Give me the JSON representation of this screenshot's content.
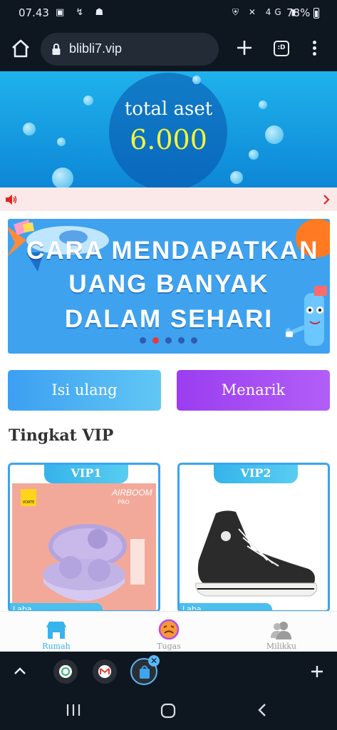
{
  "status_bar": {
    "time": "07.43",
    "battery": "78%",
    "network": "4G"
  },
  "browser": {
    "url": "blibli7.vip",
    "tabs_label": ":D"
  },
  "hero": {
    "title": "total aset",
    "value": "6.000"
  },
  "banner": {
    "line1": "CARA MENDAPATKAN",
    "line2": "UANG BANYAK",
    "line3": "DALAM SEHARI",
    "slide_count": 5,
    "active_slide": 2
  },
  "actions": {
    "recharge_label": "Isi ulang",
    "withdraw_label": "Menarik"
  },
  "vip_section": {
    "title": "Tingkat VIP",
    "cards": [
      {
        "tab": "VIP1",
        "brand": "AIRBOOM",
        "brand_sub": "PRO",
        "logo": "VORTE",
        "foot": "Laba"
      },
      {
        "tab": "VIP2",
        "foot": "Laba"
      }
    ]
  },
  "app_nav": {
    "items": [
      {
        "label": "Rumah",
        "icon": "shop-icon",
        "active": true
      },
      {
        "label": "Tugas",
        "icon": "task-icon",
        "active": false
      },
      {
        "label": "Milikku",
        "icon": "users-icon",
        "active": false
      }
    ]
  },
  "colors": {
    "accent_blue": "#3ba3ef",
    "accent_purple": "#9b3df1",
    "hero_value": "#f3f53a"
  }
}
